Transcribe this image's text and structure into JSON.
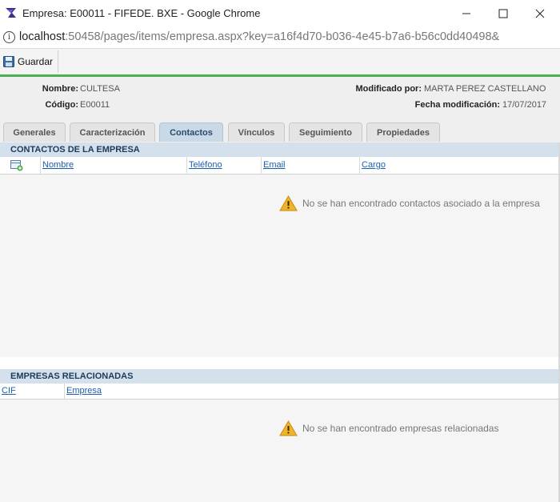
{
  "window": {
    "title": "Empresa: E00011 - FIFEDE. BXE - Google Chrome",
    "minimize_icon": "minimize-icon",
    "maximize_icon": "maximize-icon",
    "close_icon": "close-icon"
  },
  "address": {
    "host": "localhost",
    "rest": ":50458/pages/items/empresa.aspx?key=a16f4d70-b036-4e45-b7a6-b56c0dd40498&"
  },
  "toolbar": {
    "save_label": "Guardar"
  },
  "header": {
    "nombre_label": "Nombre:",
    "nombre_value": "CULTESA",
    "codigo_label": "Código:",
    "codigo_value": "E00011",
    "modificado_label": "Modificado por:",
    "modificado_value": "MARTA PEREZ CASTELLANO",
    "fecha_label": "Fecha modificación:",
    "fecha_value": "17/07/2017"
  },
  "tabs": [
    {
      "label": "Generales"
    },
    {
      "label": "Caracterización"
    },
    {
      "label": "Contactos"
    },
    {
      "label": "Vínculos"
    },
    {
      "label": "Seguimiento"
    },
    {
      "label": "Propiedades"
    }
  ],
  "active_tab": "Contactos",
  "contactos": {
    "title": "CONTACTOS DE LA EMPRESA",
    "columns": [
      "Nombre",
      "Teléfono",
      "Email",
      "Cargo"
    ],
    "empty_message": "No se han encontrado contactos asociado a la empresa"
  },
  "empresas": {
    "title": "EMPRESAS RELACIONADAS",
    "columns": [
      "CIF",
      "Empresa"
    ],
    "empty_message": "No se han encontrado empresas relacionadas"
  },
  "colors": {
    "accent_bar": "#4caf50",
    "section_bg": "#d4e1ed",
    "active_tab_bg": "#c9d9e8",
    "link": "#1a5fb4",
    "warning": "#f0b429"
  }
}
